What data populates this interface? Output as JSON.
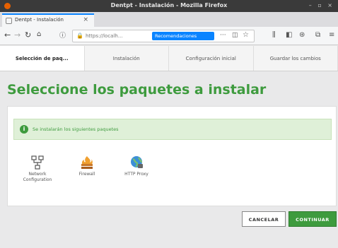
{
  "window": {
    "title": "Dentpt - Instalación - Mozilla Firefox"
  },
  "tab": {
    "label": "Dentpt - Instalación",
    "new_tab_label": "+"
  },
  "toolbar": {
    "url": "https://localh...",
    "suggestion_label": "Recomendaciones"
  },
  "steps": [
    {
      "label": "Selección de paq...",
      "active": true
    },
    {
      "label": "Instalación",
      "active": false
    },
    {
      "label": "Configuración inicial",
      "active": false
    },
    {
      "label": "Guardar los cambios",
      "active": false
    }
  ],
  "page": {
    "title": "Seleccione los paquetes a instalar",
    "info_message": "Se instalarán los siguientes paquetes"
  },
  "packages": [
    {
      "label": "Network Configuration",
      "icon": "network-icon"
    },
    {
      "label": "Firewall",
      "icon": "firewall-icon"
    },
    {
      "label": "HTTP Proxy",
      "icon": "proxy-globe-icon"
    }
  ],
  "buttons": {
    "cancel": "CANCELAR",
    "continue": "CONTINUAR"
  },
  "colors": {
    "accent_green": "#3e9b3e",
    "info_bg": "#dff0d8",
    "browser_blue": "#0a84ff"
  }
}
